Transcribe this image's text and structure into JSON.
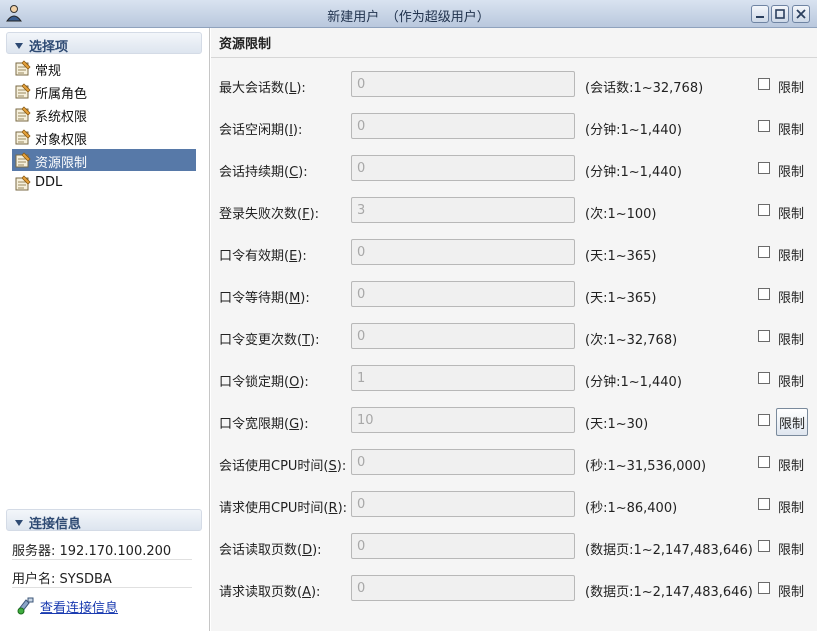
{
  "window": {
    "title": "新建用户　（作为超级用户）"
  },
  "sidebar": {
    "options_header": "选择项",
    "items": [
      {
        "label": "常规"
      },
      {
        "label": "所属角色"
      },
      {
        "label": "系统权限"
      },
      {
        "label": "对象权限"
      },
      {
        "label": "资源限制",
        "selected": true
      },
      {
        "label": "DDL"
      }
    ],
    "conn_header": "连接信息",
    "server": "服务器: 192.170.100.200",
    "user": "用户名: SYSDBA",
    "view_conn_link": "查看连接信息"
  },
  "main": {
    "title": "资源限制",
    "limit_label": "限制",
    "rows": [
      {
        "pre": "最大会话数(",
        "key": "L",
        "post": "):",
        "value": "0",
        "range": "(会话数:1~32,768)"
      },
      {
        "pre": "会话空闲期(",
        "key": "I",
        "post": "):",
        "value": "0",
        "range": "(分钟:1~1,440)"
      },
      {
        "pre": "会话持续期(",
        "key": "C",
        "post": "):",
        "value": "0",
        "range": "(分钟:1~1,440)"
      },
      {
        "pre": "登录失败次数(",
        "key": "F",
        "post": "):",
        "value": "3",
        "range": "(次:1~100)"
      },
      {
        "pre": "口令有效期(",
        "key": "E",
        "post": "):",
        "value": "0",
        "range": "(天:1~365)"
      },
      {
        "pre": "口令等待期(",
        "key": "M",
        "post": "):",
        "value": "0",
        "range": "(天:1~365)"
      },
      {
        "pre": "口令变更次数(",
        "key": "T",
        "post": "):",
        "value": "0",
        "range": "(次:1~32,768)"
      },
      {
        "pre": "口令锁定期(",
        "key": "O",
        "post": "):",
        "value": "1",
        "range": "(分钟:1~1,440)"
      },
      {
        "pre": "口令宽限期(",
        "key": "G",
        "post": "):",
        "value": "10",
        "range": "(天:1~30)"
      },
      {
        "pre": "会话使用CPU时间(",
        "key": "S",
        "post": "):",
        "value": "0",
        "range": "(秒:1~31,536,000)"
      },
      {
        "pre": "请求使用CPU时间(",
        "key": "R",
        "post": "):",
        "value": "0",
        "range": "(秒:1~86,400)"
      },
      {
        "pre": "会话读取页数(",
        "key": "D",
        "post": "):",
        "value": "0",
        "range": "(数据页:1~2,147,483,646)"
      },
      {
        "pre": "请求读取页数(",
        "key": "A",
        "post": "):",
        "value": "0",
        "range": "(数据页:1~2,147,483,646)"
      }
    ]
  },
  "colors": {
    "selection": "#5779a8",
    "link": "#1a3bb0",
    "section_header_text": "#2e4a73"
  }
}
